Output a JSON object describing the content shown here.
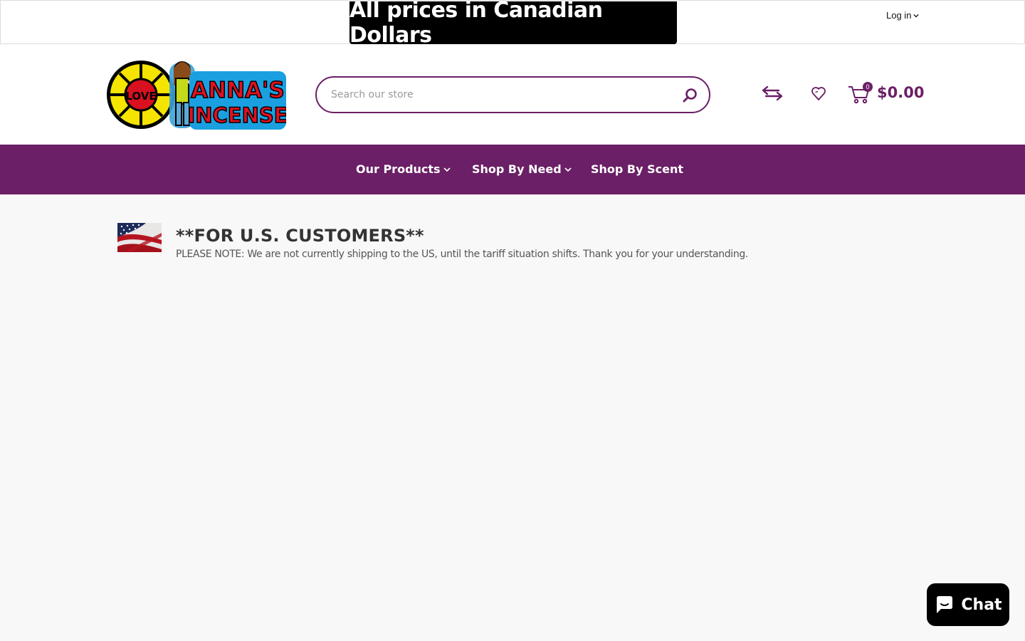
{
  "banner": {
    "text": "All prices in Canadian Dollars"
  },
  "account": {
    "login_label": "Log in"
  },
  "brand": {
    "name": "Anna's Incense",
    "logo_text_top": "ANNA'S",
    "logo_text_bottom": "INCENSE",
    "logo_badge": "LOVE"
  },
  "search": {
    "placeholder": "Search our store",
    "value": ""
  },
  "cart": {
    "count": "0",
    "total": "$0.00"
  },
  "nav": {
    "items": [
      {
        "label": "Our Products",
        "has_dropdown": true
      },
      {
        "label": "Shop By Need",
        "has_dropdown": true
      },
      {
        "label": "Shop By Scent",
        "has_dropdown": false
      }
    ]
  },
  "notice": {
    "title": "**FOR U.S. CUSTOMERS**",
    "text": "PLEASE NOTE: We are not currently shipping to the US, until the tariff situation shifts. Thank you for your understanding."
  },
  "chat": {
    "label": "Chat"
  },
  "colors": {
    "brand_purple": "#6b1f66",
    "banner_bg": "#000000",
    "page_bg": "#f9f8f8"
  },
  "icons": [
    "chevron-down-icon",
    "search-icon",
    "compare-icon",
    "heart-icon",
    "cart-icon",
    "chat-icon",
    "us-flag"
  ]
}
